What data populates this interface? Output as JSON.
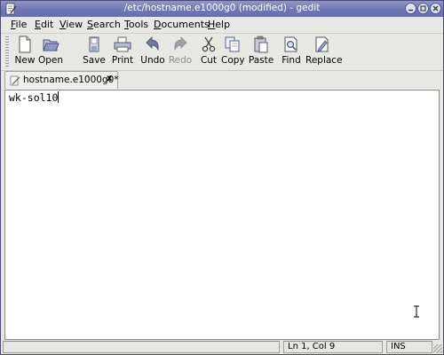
{
  "window": {
    "title": "/etc/hostname.e1000g0 (modified) - gedit"
  },
  "menu": [
    {
      "pre": "",
      "u": "F",
      "post": "ile"
    },
    {
      "pre": "",
      "u": "E",
      "post": "dit"
    },
    {
      "pre": "",
      "u": "V",
      "post": "iew"
    },
    {
      "pre": "",
      "u": "S",
      "post": "earch"
    },
    {
      "pre": "",
      "u": "T",
      "post": "ools"
    },
    {
      "pre": "",
      "u": "D",
      "post": "ocuments"
    },
    {
      "pre": "",
      "u": "H",
      "post": "elp"
    }
  ],
  "toolbar": {
    "new": "New",
    "open": "Open",
    "save": "Save",
    "print": "Print",
    "undo": "Undo",
    "redo": "Redo",
    "cut": "Cut",
    "copy": "Copy",
    "paste": "Paste",
    "find": "Find",
    "replace": "Replace"
  },
  "tab": {
    "label": "hostname.e1000g0*",
    "close": "x"
  },
  "editor": {
    "content": "wk-sol10"
  },
  "status": {
    "position": "Ln 1, Col 9",
    "mode": "INS"
  },
  "colors": {
    "titlebar": "#7078b4",
    "window_bg": "#e8e8e4",
    "editor_bg": "#ffffff"
  }
}
